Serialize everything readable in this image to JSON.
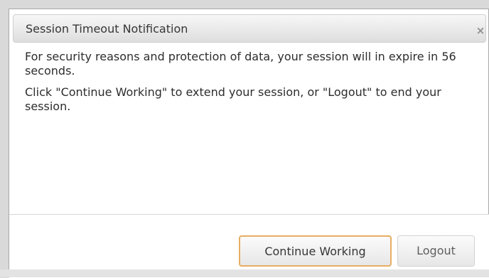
{
  "dialog": {
    "title": "Session Timeout Notification",
    "close_label": "×",
    "message_1": "For security reasons and protection of data, your session will in expire in 56 seconds.",
    "message_2": "Click \"Continue Working\" to extend your session, or \"Logout\" to end your session.",
    "continue_button_label": "Continue Working",
    "logout_button_label": "Logout"
  },
  "colors": {
    "accent": "#e7ae63",
    "title_text": "#363636",
    "body_text": "#2d2d2d",
    "page_background": "#d9d9d9"
  },
  "icons": {
    "close": "close-icon"
  }
}
